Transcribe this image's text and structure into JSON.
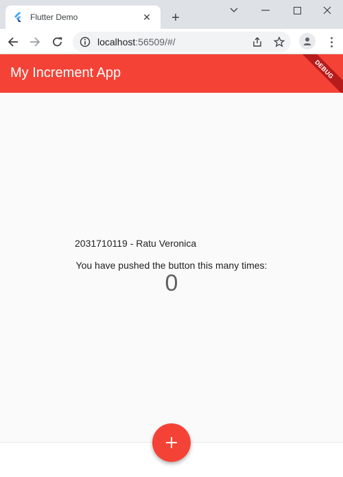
{
  "browser": {
    "tab": {
      "title": "Flutter Demo",
      "close_label": "✕"
    },
    "new_tab_label": "+",
    "address": {
      "host": "localhost",
      "path": ":56509/#/"
    }
  },
  "app": {
    "title": "My Increment App",
    "debug_banner": "DEBUG",
    "student_label": "2031710119 - Ratu Veronica",
    "pushed_text": "You have pushed the button this many times:",
    "counter": "0",
    "fab_label": "+"
  },
  "colors": {
    "app_bar": "#f44336",
    "fab": "#f44336",
    "debug_banner": "#b71c1c",
    "background": "#fafafa"
  },
  "icons": {
    "favicon": "flutter-logo-icon",
    "back": "arrow-left-icon",
    "forward": "arrow-right-icon",
    "reload": "reload-icon",
    "info": "info-icon",
    "share": "share-icon",
    "bookmark": "star-icon",
    "profile": "person-icon",
    "menu": "more-vertical-icon",
    "fab": "plus-icon"
  }
}
